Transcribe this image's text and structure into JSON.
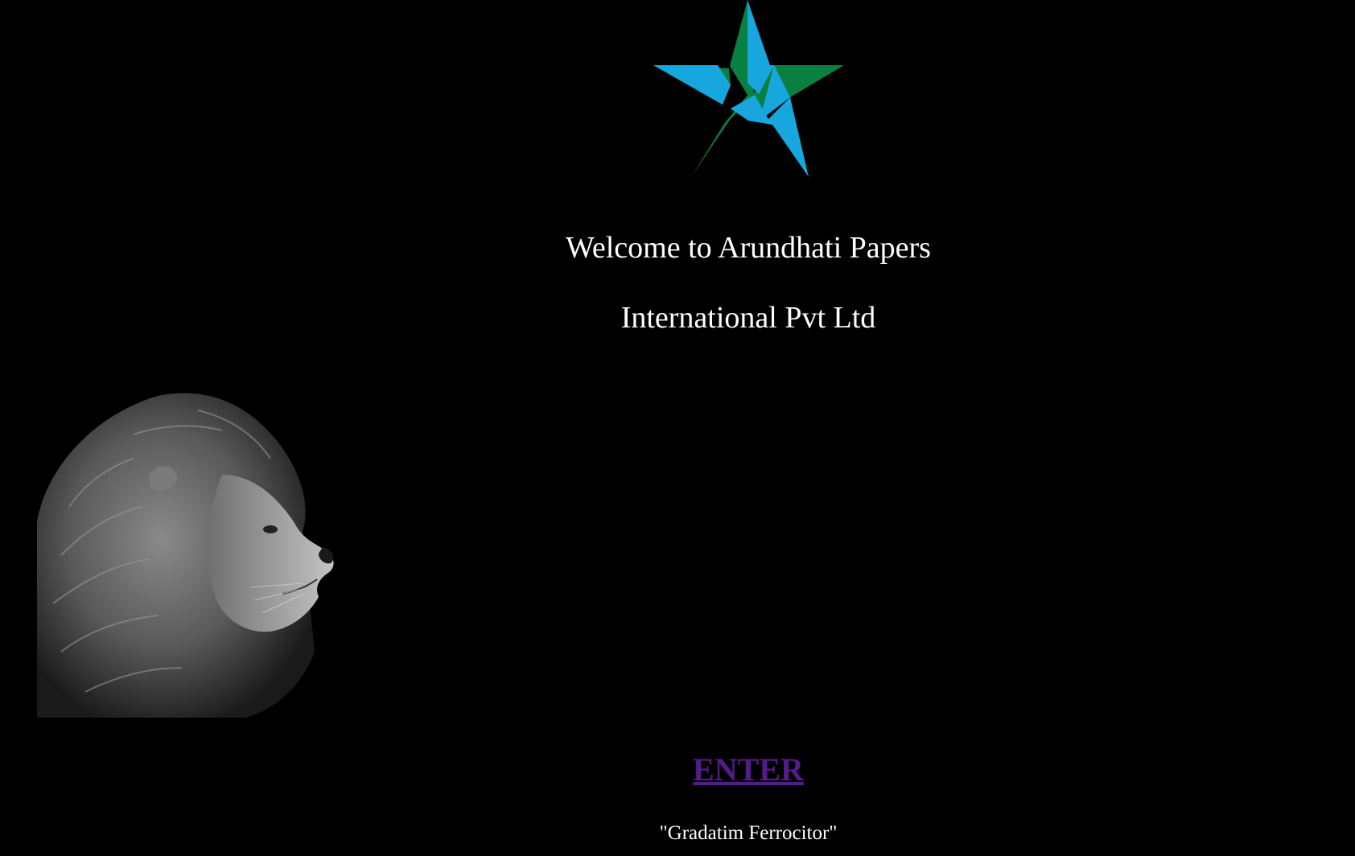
{
  "logo": {
    "icon": "star-logo-icon",
    "colors": {
      "green": "#0a8040",
      "blue": "#17a7de"
    }
  },
  "heading": {
    "line1": "Welcome to Arundhati Papers",
    "line2": "International Pvt Ltd"
  },
  "lion_image": {
    "icon": "lion-profile-image"
  },
  "enter_link": {
    "label": "ENTER",
    "color": "#551a8b"
  },
  "motto": "\"Gradatim Ferrocitor\"",
  "colors": {
    "background": "#000000",
    "text": "#ffffff"
  }
}
